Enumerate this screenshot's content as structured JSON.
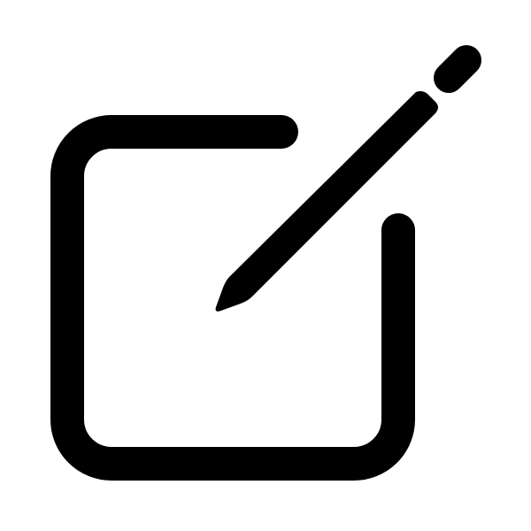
{
  "icon": {
    "name": "edit-icon",
    "color": "#000000",
    "background": "#ffffff"
  }
}
